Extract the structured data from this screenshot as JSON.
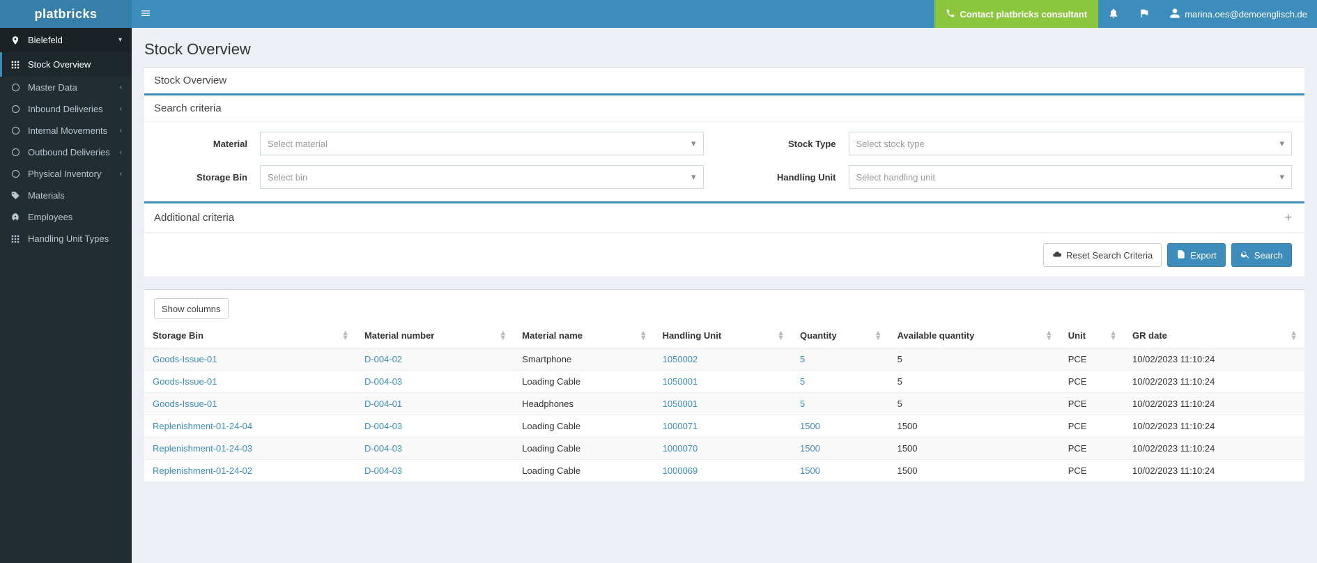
{
  "brand": "platbricks",
  "topbar": {
    "consultant": "Contact platbricks consultant",
    "user": "marina.oes@demoenglisch.de"
  },
  "sidebar": {
    "location": "Bielefeld",
    "items": [
      {
        "label": "Stock Overview",
        "icon": "grid",
        "active": true
      },
      {
        "label": "Master Data",
        "icon": "circle",
        "expandable": true
      },
      {
        "label": "Inbound Deliveries",
        "icon": "circle",
        "expandable": true
      },
      {
        "label": "Internal Movements",
        "icon": "circle",
        "expandable": true
      },
      {
        "label": "Outbound Deliveries",
        "icon": "circle",
        "expandable": true
      },
      {
        "label": "Physical Inventory",
        "icon": "circle",
        "expandable": true
      },
      {
        "label": "Materials",
        "icon": "tag"
      },
      {
        "label": "Employees",
        "icon": "rocket"
      },
      {
        "label": "Handling Unit Types",
        "icon": "grid"
      }
    ]
  },
  "page": {
    "title": "Stock Overview",
    "panel_title": "Stock Overview",
    "search_criteria_title": "Search criteria",
    "additional_criteria_title": "Additional criteria",
    "fields": {
      "material": {
        "label": "Material",
        "placeholder": "Select material"
      },
      "storage_bin": {
        "label": "Storage Bin",
        "placeholder": "Select bin"
      },
      "stock_type": {
        "label": "Stock Type",
        "placeholder": "Select stock type"
      },
      "handling_unit": {
        "label": "Handling Unit",
        "placeholder": "Select handling unit"
      }
    },
    "buttons": {
      "reset": "Reset Search Criteria",
      "export": "Export",
      "search": "Search",
      "show_columns": "Show columns"
    }
  },
  "table": {
    "headers": [
      "Storage Bin",
      "Material number",
      "Material name",
      "Handling Unit",
      "Quantity",
      "Available quantity",
      "Unit",
      "GR date"
    ],
    "rows": [
      {
        "bin": "Goods-Issue-01",
        "matnum": "D-004-02",
        "matname": "Smartphone",
        "hu": "1050002",
        "qty": "5",
        "aqty": "5",
        "unit": "PCE",
        "gr": "10/02/2023 11:10:24"
      },
      {
        "bin": "Goods-Issue-01",
        "matnum": "D-004-03",
        "matname": "Loading Cable",
        "hu": "1050001",
        "qty": "5",
        "aqty": "5",
        "unit": "PCE",
        "gr": "10/02/2023 11:10:24"
      },
      {
        "bin": "Goods-Issue-01",
        "matnum": "D-004-01",
        "matname": "Headphones",
        "hu": "1050001",
        "qty": "5",
        "aqty": "5",
        "unit": "PCE",
        "gr": "10/02/2023 11:10:24"
      },
      {
        "bin": "Replenishment-01-24-04",
        "matnum": "D-004-03",
        "matname": "Loading Cable",
        "hu": "1000071",
        "qty": "1500",
        "aqty": "1500",
        "unit": "PCE",
        "gr": "10/02/2023 11:10:24"
      },
      {
        "bin": "Replenishment-01-24-03",
        "matnum": "D-004-03",
        "matname": "Loading Cable",
        "hu": "1000070",
        "qty": "1500",
        "aqty": "1500",
        "unit": "PCE",
        "gr": "10/02/2023 11:10:24"
      },
      {
        "bin": "Replenishment-01-24-02",
        "matnum": "D-004-03",
        "matname": "Loading Cable",
        "hu": "1000069",
        "qty": "1500",
        "aqty": "1500",
        "unit": "PCE",
        "gr": "10/02/2023 11:10:24"
      }
    ]
  }
}
